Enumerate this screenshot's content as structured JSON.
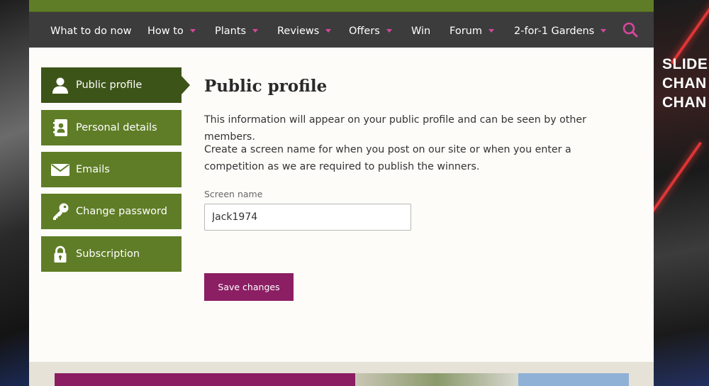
{
  "ad": {
    "lines": [
      "SLIDE",
      "CHAN",
      "CHAN"
    ]
  },
  "nav": {
    "items": [
      {
        "label": "What to do now",
        "has_dropdown": false
      },
      {
        "label": "How to",
        "has_dropdown": true
      },
      {
        "label": "Plants",
        "has_dropdown": true
      },
      {
        "label": "Reviews",
        "has_dropdown": true
      },
      {
        "label": "Offers",
        "has_dropdown": true
      },
      {
        "label": "Win",
        "has_dropdown": false
      },
      {
        "label": "Forum",
        "has_dropdown": true
      },
      {
        "label": "2-for-1 Gardens",
        "has_dropdown": true
      }
    ],
    "search_icon": "search-icon"
  },
  "sidebar": {
    "items": [
      {
        "label": "Public profile",
        "icon": "person-icon",
        "active": true
      },
      {
        "label": "Personal details",
        "icon": "address-book-icon",
        "active": false
      },
      {
        "label": "Emails",
        "icon": "envelope-icon",
        "active": false
      },
      {
        "label": "Change password",
        "icon": "key-icon",
        "active": false
      },
      {
        "label": "Subscription",
        "icon": "lock-icon",
        "active": false
      }
    ]
  },
  "main": {
    "title": "Public profile",
    "intro": "This information will appear on your public profile and can be seen by other members.",
    "instructions": "Create a screen name for when you post on our site or when you enter a competition as we are required to publish the winners.",
    "screen_name": {
      "label": "Screen name",
      "value": "Jack1974"
    },
    "save_label": "Save changes"
  },
  "colors": {
    "brand_green": "#5f7d26",
    "active_green": "#3d5418",
    "nav_bg": "#3c3c3c",
    "accent_magenta": "#8c1e64",
    "caret_pink": "#d6479b"
  }
}
